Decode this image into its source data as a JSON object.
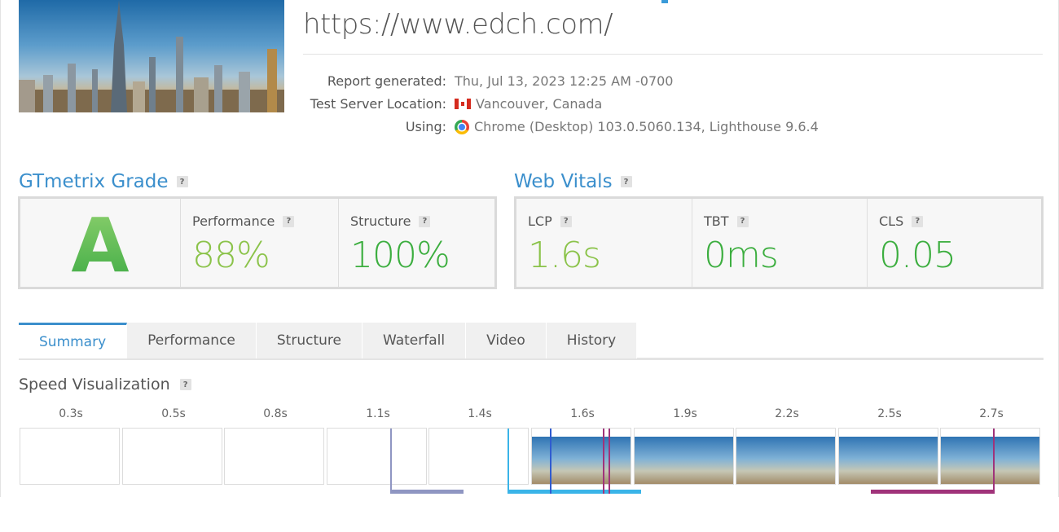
{
  "header": {
    "url": "https://www.edch.com/"
  },
  "report": {
    "generated_label": "Report generated:",
    "generated_value": "Thu, Jul 13, 2023 12:25 AM -0700",
    "location_label": "Test Server Location:",
    "location_value": "Vancouver, Canada",
    "using_label": "Using:",
    "using_value": "Chrome (Desktop) 103.0.5060.134, Lighthouse 9.6.4",
    "location_icon": "canada-flag-icon",
    "browser_icon": "chrome-icon"
  },
  "grade": {
    "title": "GTmetrix Grade",
    "help": "?",
    "letter": "A",
    "performance_label": "Performance",
    "performance_value": "88%",
    "structure_label": "Structure",
    "structure_value": "100%"
  },
  "vitals": {
    "title": "Web Vitals",
    "help": "?",
    "lcp_label": "LCP",
    "lcp_value": "1.6s",
    "tbt_label": "TBT",
    "tbt_value": "0ms",
    "cls_label": "CLS",
    "cls_value": "0.05"
  },
  "tabs": [
    {
      "label": "Summary",
      "active": true
    },
    {
      "label": "Performance",
      "active": false
    },
    {
      "label": "Structure",
      "active": false
    },
    {
      "label": "Waterfall",
      "active": false
    },
    {
      "label": "Video",
      "active": false
    },
    {
      "label": "History",
      "active": false
    }
  ],
  "speed_visualization": {
    "title": "Speed Visualization",
    "help": "?",
    "frames": [
      {
        "time": "0.3s",
        "rendered": false
      },
      {
        "time": "0.5s",
        "rendered": false
      },
      {
        "time": "0.8s",
        "rendered": false
      },
      {
        "time": "1.1s",
        "rendered": false
      },
      {
        "time": "1.4s",
        "rendered": false
      },
      {
        "time": "1.6s",
        "rendered": true
      },
      {
        "time": "1.9s",
        "rendered": true
      },
      {
        "time": "2.2s",
        "rendered": true
      },
      {
        "time": "2.5s",
        "rendered": true
      },
      {
        "time": "2.7s",
        "rendered": true
      }
    ]
  },
  "colors": {
    "accent": "#3b8fcc",
    "grade_green": "#47b649",
    "score_green": "#7ac143",
    "marker_ttfb": "#8f96c2",
    "marker_fcp": "#3ab4e8",
    "marker_lcp": "#2f5bd0",
    "marker_tti": "#a0337a"
  }
}
